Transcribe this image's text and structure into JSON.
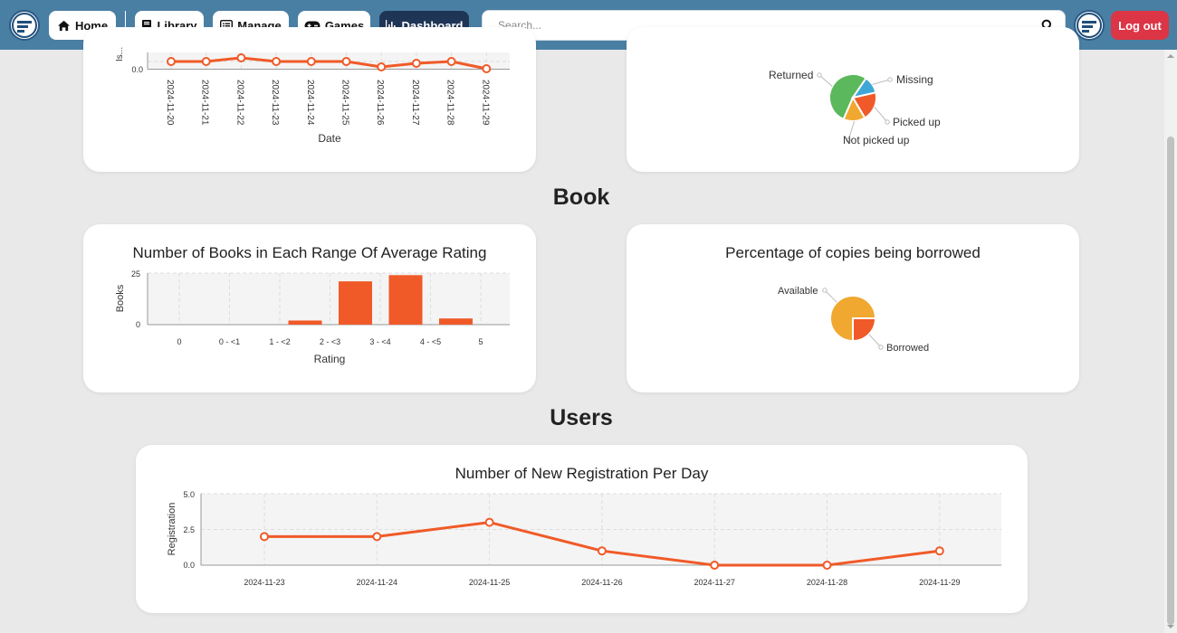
{
  "nav": {
    "home": "Home",
    "library": "Library",
    "manage": "Manage",
    "games": "Games",
    "dashboard": "Dashboard",
    "search_placeholder": "Search...",
    "logout": "Log out"
  },
  "sections": {
    "book": "Book",
    "users": "Users"
  },
  "charts": {
    "issues_per_day": {
      "ylabel": "Is...",
      "xlabel": "Date",
      "ytick_label": "0.0",
      "x": [
        "2024-11-20",
        "2024-11-21",
        "2024-11-22",
        "2024-11-23",
        "2024-11-24",
        "2024-11-25",
        "2024-11-26",
        "2024-11-27",
        "2024-11-28",
        "2024-11-29"
      ]
    },
    "copies_status": {
      "labels": [
        "Returned",
        "Missing",
        "Picked up",
        "Not picked up"
      ]
    },
    "books_rating": {
      "title": "Number of Books in Each Range Of Average Rating",
      "xlabel": "Rating",
      "ylabel": "Books",
      "yticks": [
        "25",
        "0"
      ],
      "categories": [
        "0",
        "0 - <1",
        "1 - <2",
        "2 - <3",
        "3 - <4",
        "4 - <5",
        "5"
      ]
    },
    "copies_borrowed": {
      "title": "Percentage of copies being borrowed",
      "labels": [
        "Available",
        "Borrowed"
      ]
    },
    "registrations": {
      "title": "Number of New Registration Per Day",
      "ylabel": "Registration",
      "yticks": [
        "5.0",
        "2.5",
        "0.0"
      ],
      "x": [
        "2024-11-23",
        "2024-11-24",
        "2024-11-25",
        "2024-11-26",
        "2024-11-27",
        "2024-11-28",
        "2024-11-29"
      ]
    }
  },
  "chart_data": [
    {
      "type": "line",
      "x": [
        "2024-11-20",
        "2024-11-21",
        "2024-11-22",
        "2024-11-23",
        "2024-11-24",
        "2024-11-25",
        "2024-11-26",
        "2024-11-27",
        "2024-11-28",
        "2024-11-29"
      ],
      "values": [
        2,
        2,
        3,
        2,
        2,
        2,
        0.5,
        1.5,
        2,
        0
      ],
      "xlabel": "Date",
      "ylabel": "Is...",
      "color": "#f05a28"
    },
    {
      "type": "pie",
      "labels": [
        "Returned",
        "Missing",
        "Picked up",
        "Not picked up"
      ],
      "values": [
        53,
        12,
        20,
        15
      ],
      "colors": [
        "#5cb85c",
        "#3fa7d6",
        "#f05a28",
        "#f0a830"
      ]
    },
    {
      "type": "bar",
      "title": "Number of Books in Each Range Of Average Rating",
      "categories": [
        "0",
        "0 - <1",
        "1 - <2",
        "2 - <3",
        "3 - <4",
        "4 - <5",
        "5"
      ],
      "values": [
        0,
        0,
        2,
        21,
        24,
        3,
        0
      ],
      "xlabel": "Rating",
      "ylabel": "Books",
      "ylim": [
        0,
        25
      ],
      "color": "#f05a28"
    },
    {
      "type": "pie",
      "title": "Percentage of copies being borrowed",
      "labels": [
        "Available",
        "Borrowed"
      ],
      "values": [
        75,
        25
      ],
      "colors": [
        "#f0a830",
        "#f05a28"
      ]
    },
    {
      "type": "line",
      "title": "Number of New Registration Per Day",
      "x": [
        "2024-11-23",
        "2024-11-24",
        "2024-11-25",
        "2024-11-26",
        "2024-11-27",
        "2024-11-28",
        "2024-11-29"
      ],
      "values": [
        2,
        2,
        3,
        1,
        0,
        0,
        1
      ],
      "ylabel": "Registration",
      "ylim": [
        0,
        5
      ],
      "color": "#f05a28"
    }
  ]
}
